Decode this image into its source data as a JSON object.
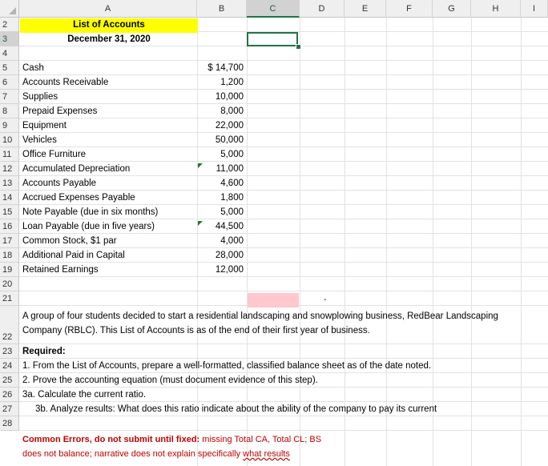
{
  "columns": [
    "A",
    "B",
    "C",
    "D",
    "E",
    "F",
    "G",
    "H",
    "I"
  ],
  "rows": [
    "2",
    "3",
    "4",
    "5",
    "6",
    "7",
    "8",
    "9",
    "10",
    "11",
    "12",
    "13",
    "14",
    "15",
    "16",
    "17",
    "18",
    "19",
    "20",
    "21",
    "22",
    "23",
    "24",
    "25",
    "26",
    "27",
    "28"
  ],
  "title": "List of Accounts",
  "date": "December 31, 2020",
  "accounts": [
    {
      "name": "Cash",
      "amount": "$ 14,700"
    },
    {
      "name": "Accounts Receivable",
      "amount": "1,200"
    },
    {
      "name": "Supplies",
      "amount": "10,000"
    },
    {
      "name": "Prepaid Expenses",
      "amount": "8,000"
    },
    {
      "name": "Equipment",
      "amount": "22,000"
    },
    {
      "name": "Vehicles",
      "amount": "50,000"
    },
    {
      "name": "Office Furniture",
      "amount": "5,000"
    },
    {
      "name": "Accumulated Depreciation",
      "amount": "11,000"
    },
    {
      "name": "Accounts Payable",
      "amount": "4,600"
    },
    {
      "name": "Accrued Expenses Payable",
      "amount": "1,800"
    },
    {
      "name": "Note Payable (due in six months)",
      "amount": "5,000"
    },
    {
      "name": "Loan Payable (due in five years)",
      "amount": "44,500"
    },
    {
      "name": "Common Stock, $1 par",
      "amount": "4,000"
    },
    {
      "name": "Additional Paid in Capital",
      "amount": "28,000"
    },
    {
      "name": "Retained Earnings",
      "amount": "12,000"
    }
  ],
  "row21_mark": "-",
  "description": "A group of four students decided to start a residential landscaping and snowplowing business, RedBear Landscaping Company (RBLC). This List of Accounts is as of the end of their first year of business.",
  "required_label": "Required:",
  "required_items": [
    "1. From the List of Accounts, prepare a well-formatted, classified balance sheet as of the date noted.",
    "2. Prove the accounting equation (must document evidence of this step).",
    "3a. Calculate the current ratio.",
    "3b. Analyze results: What does this ratio indicate about the ability of the company to pay its current"
  ],
  "errors_label": "Common Errors, do not submit until fixed:",
  "errors_text_1": " missing Total CA, Total CL; BS",
  "errors_text_2": "does not balance; narrative does not explain specifically ",
  "errors_text_3": "what results",
  "colors": {
    "accent": "#217346",
    "highlight_yellow": "#ffff00",
    "highlight_pink": "#ffc7ce",
    "error_red": "#c00000"
  }
}
